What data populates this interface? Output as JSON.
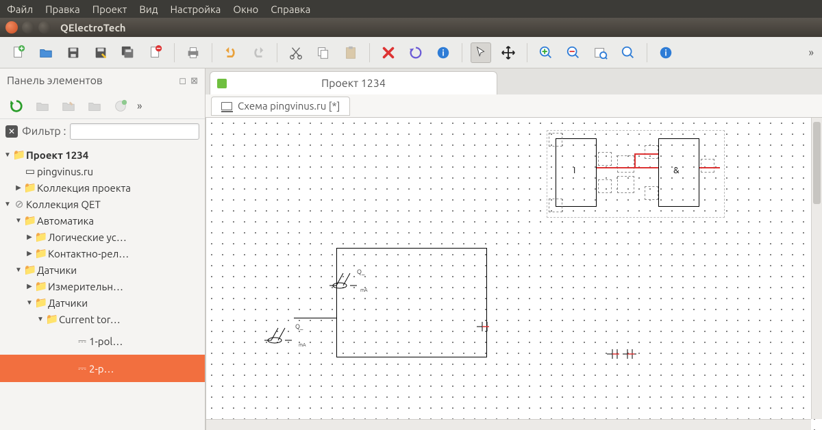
{
  "menubar": {
    "items": [
      "Файл",
      "Правка",
      "Проект",
      "Вид",
      "Настройка",
      "Окно",
      "Справка"
    ]
  },
  "window": {
    "title": "QElectroTech"
  },
  "panel": {
    "title": "Панель элементов",
    "filter_label": "Фильтр :",
    "filter_value": "",
    "tree": {
      "n0": "Проект 1234",
      "n0a": "pingvinus.ru",
      "n0b": "Коллекция проекта",
      "n1": "Коллекция QET",
      "n1a": "Автоматика",
      "n1a1": "Логические ус…",
      "n1a2": "Контактно-рел…",
      "n1b": "Датчики",
      "n1b1": "Измерительн…",
      "n1b2": "Датчики",
      "n1b2a": "Current tor…",
      "item1": "1-pol…",
      "item2": "2-p…"
    }
  },
  "tabs": {
    "project": "Проект 1234",
    "schema": "Схема pingvinus.ru [*]"
  },
  "schematic": {
    "gate1": "I",
    "gate2": "&",
    "q1": "Q_",
    "q2": "Q_",
    "ma": "mA"
  },
  "overflow": "»"
}
